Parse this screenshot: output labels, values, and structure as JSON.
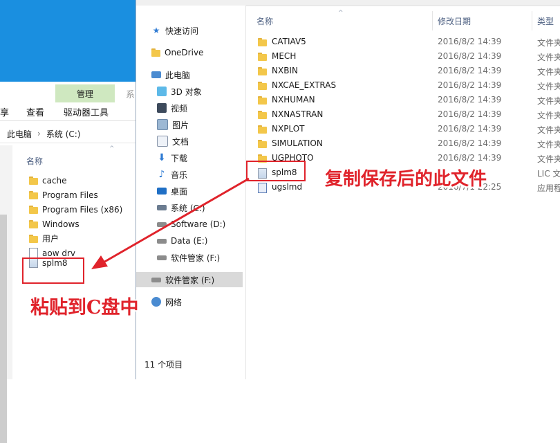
{
  "back_window": {
    "ribbon": {
      "manage_label": "管理",
      "share_label": "享",
      "view_label": "查看",
      "drive_tools_label": "驱动器工具",
      "context_stub": "系"
    },
    "breadcrumb": [
      "此电脑",
      "系统 (C:)"
    ],
    "column_name": "名称",
    "items": [
      {
        "name": "cache",
        "icon": "folder-icon"
      },
      {
        "name": "Program Files",
        "icon": "folder-icon"
      },
      {
        "name": "Program Files (x86)",
        "icon": "folder-icon"
      },
      {
        "name": "Windows",
        "icon": "folder-icon"
      },
      {
        "name": "用户",
        "icon": "folder-icon"
      },
      {
        "name": "aow drv",
        "icon": "file-icon"
      },
      {
        "name": "splm8",
        "icon": "license-file-icon"
      }
    ]
  },
  "front_window": {
    "nav": [
      {
        "label": "快速访问",
        "icon": "star-icon"
      },
      {
        "label": "OneDrive",
        "icon": "folder-icon"
      },
      {
        "label": "此电脑",
        "icon": "computer-icon"
      },
      {
        "label": "3D 对象",
        "icon": "cube-icon"
      },
      {
        "label": "视频",
        "icon": "video-icon"
      },
      {
        "label": "图片",
        "icon": "picture-icon"
      },
      {
        "label": "文档",
        "icon": "document-icon"
      },
      {
        "label": "下载",
        "icon": "download-icon"
      },
      {
        "label": "音乐",
        "icon": "music-icon"
      },
      {
        "label": "桌面",
        "icon": "desktop-icon"
      },
      {
        "label": "系统 (C:)",
        "icon": "system-drive-icon"
      },
      {
        "label": "Software (D:)",
        "icon": "drive-icon"
      },
      {
        "label": "Data (E:)",
        "icon": "drive-icon"
      },
      {
        "label": "软件管家 (F:)",
        "icon": "drive-icon"
      },
      {
        "label": "软件管家 (F:)",
        "icon": "drive-icon",
        "selected": true
      },
      {
        "label": "网络",
        "icon": "network-icon"
      }
    ],
    "columns": {
      "name": "名称",
      "date": "修改日期",
      "type": "类型"
    },
    "files": [
      {
        "name": "CATIAV5",
        "date": "2016/8/2 14:39",
        "type": "文件夹",
        "icon": "folder-icon"
      },
      {
        "name": "MECH",
        "date": "2016/8/2 14:39",
        "type": "文件夹",
        "icon": "folder-icon"
      },
      {
        "name": "NXBIN",
        "date": "2016/8/2 14:39",
        "type": "文件夹",
        "icon": "folder-icon"
      },
      {
        "name": "NXCAE_EXTRAS",
        "date": "2016/8/2 14:39",
        "type": "文件夹",
        "icon": "folder-icon"
      },
      {
        "name": "NXHUMAN",
        "date": "2016/8/2 14:39",
        "type": "文件夹",
        "icon": "folder-icon"
      },
      {
        "name": "NXNASTRAN",
        "date": "2016/8/2 14:39",
        "type": "文件夹",
        "icon": "folder-icon"
      },
      {
        "name": "NXPLOT",
        "date": "2016/8/2 14:39",
        "type": "文件夹",
        "icon": "folder-icon"
      },
      {
        "name": "SIMULATION",
        "date": "2016/8/2 14:39",
        "type": "文件夹",
        "icon": "folder-icon"
      },
      {
        "name": "UGPHOTO",
        "date": "2016/8/2 14:39",
        "type": "文件夹",
        "icon": "folder-icon"
      },
      {
        "name": "splm8",
        "date": "",
        "type": "LIC 文",
        "icon": "license-file-icon"
      },
      {
        "name": "ugslmd",
        "date": "2016/7/1 22:25",
        "type": "应用程",
        "icon": "application-icon"
      }
    ],
    "status": "11 个项目"
  },
  "annotations": {
    "front_note": "复制保存后的此文件",
    "back_note": "粘贴到C盘中",
    "color": "#e0232b"
  }
}
